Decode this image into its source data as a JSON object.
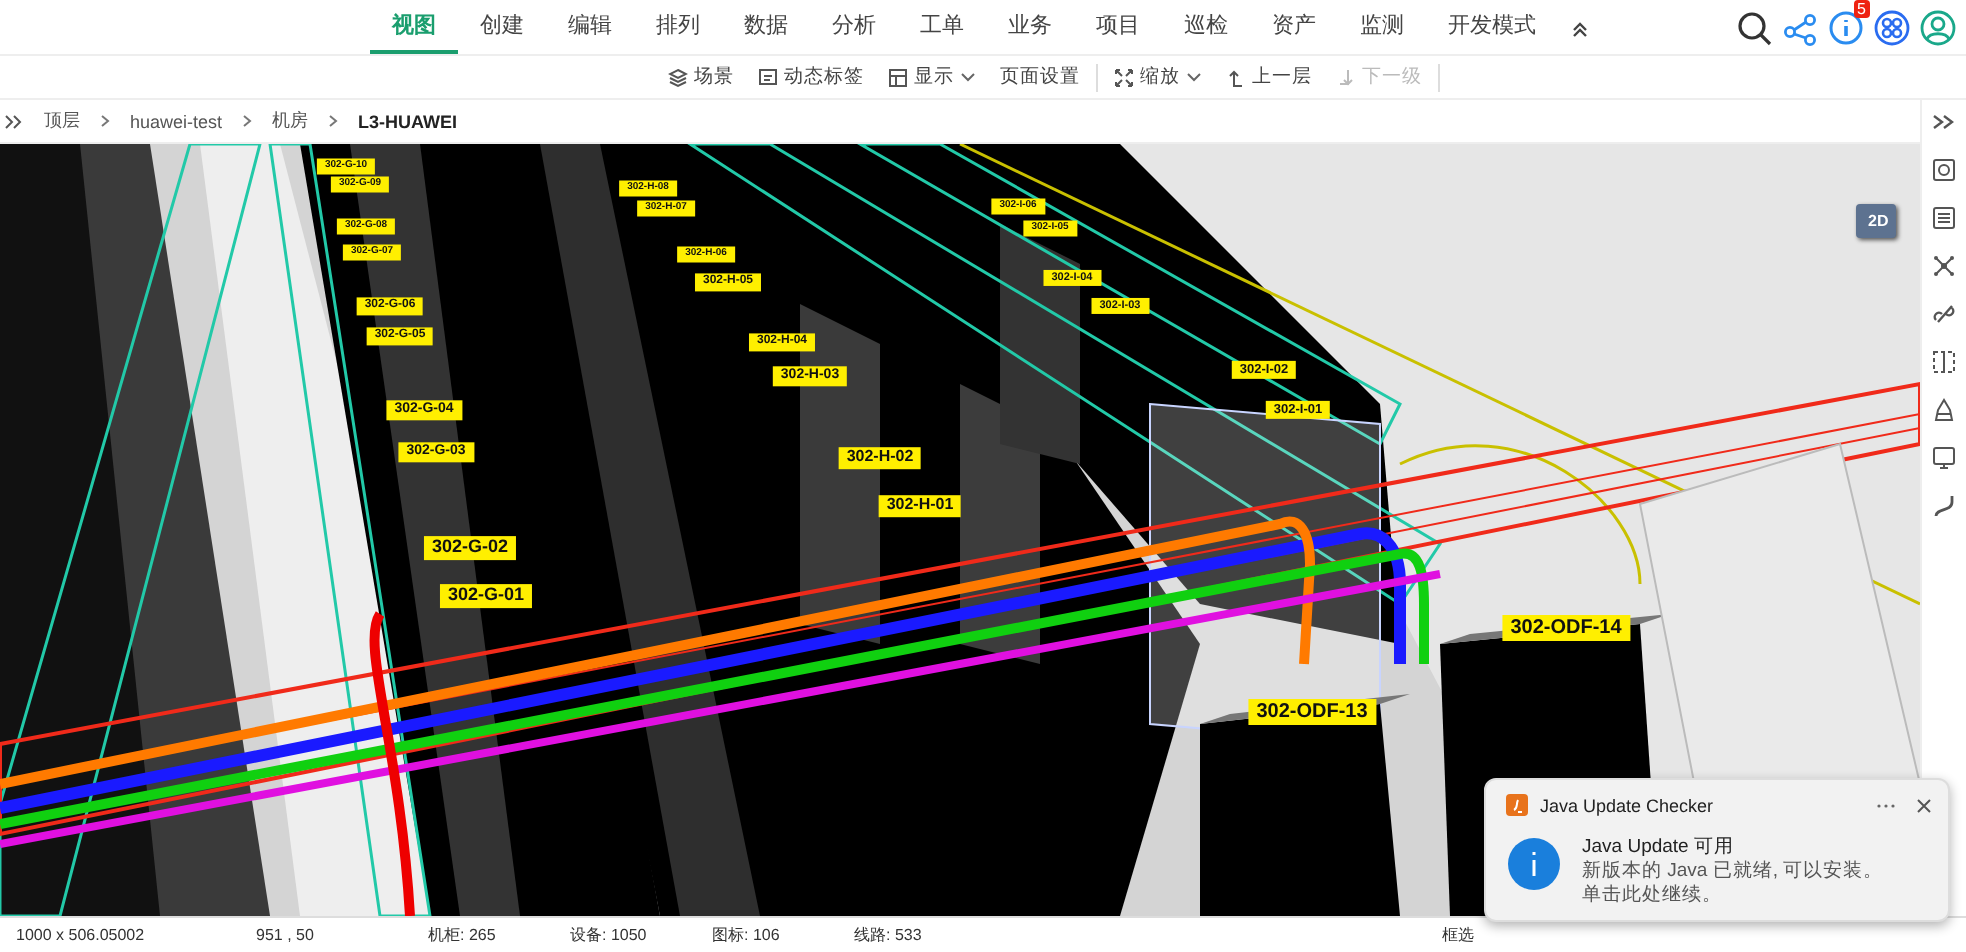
{
  "menu_tabs": [
    {
      "label": "视图",
      "selected": true
    },
    {
      "label": "创建",
      "selected": false
    },
    {
      "label": "编辑",
      "selected": false
    },
    {
      "label": "排列",
      "selected": false
    },
    {
      "label": "数据",
      "selected": false
    },
    {
      "label": "分析",
      "selected": false
    },
    {
      "label": "工单",
      "selected": false
    },
    {
      "label": "业务",
      "selected": false
    },
    {
      "label": "项目",
      "selected": false
    },
    {
      "label": "巡检",
      "selected": false
    },
    {
      "label": "资产",
      "selected": false
    },
    {
      "label": "监测",
      "selected": false
    }
  ],
  "menu_more": {
    "label": "开发模式",
    "expanded": true
  },
  "notification_badge": "5",
  "toolbar": [
    {
      "label": "场景",
      "dropdown": false,
      "disabled": false
    },
    {
      "label": "动态标签",
      "dropdown": false,
      "disabled": false
    },
    {
      "label": "显示",
      "dropdown": true,
      "disabled": false
    },
    {
      "label": "页面设置",
      "dropdown": false,
      "disabled": false
    },
    {
      "label": "缩放",
      "dropdown": true,
      "disabled": false
    },
    {
      "label": "上一层",
      "dropdown": false,
      "disabled": false
    },
    {
      "label": "下一级",
      "dropdown": false,
      "disabled": true
    }
  ],
  "breadcrumb": [
    "顶层",
    "huawei-test",
    "机房",
    "L3-HUAWEI"
  ],
  "view_toggle": "2D",
  "rack_labels": [
    "302-G-10",
    "302-G-09",
    "302-G-08",
    "302-G-07",
    "302-G-06",
    "302-G-05",
    "302-G-04",
    "302-G-03",
    "302-G-02",
    "302-G-01",
    "302-H-08",
    "302-H-07",
    "302-H-06",
    "302-H-05",
    "302-H-04",
    "302-H-03",
    "302-H-02",
    "302-H-01",
    "302-I-06",
    "302-I-05",
    "302-I-04",
    "302-I-03",
    "302-I-02",
    "302-I-01",
    "302-ODF-14",
    "302-ODF-13"
  ],
  "status_bar": {
    "size": "1000 x 506.05002",
    "coords": "951 , 50",
    "counts": [
      "机柜: 265",
      "设备: 1050",
      "图标: 106",
      "线路: 533"
    ],
    "box_select": "框选"
  },
  "toast": {
    "app": "Java Update Checker",
    "title": "Java Update 可用",
    "lines": [
      "新版本的 Java 已就绪, 可以安装。",
      "单击此处继续。"
    ]
  }
}
